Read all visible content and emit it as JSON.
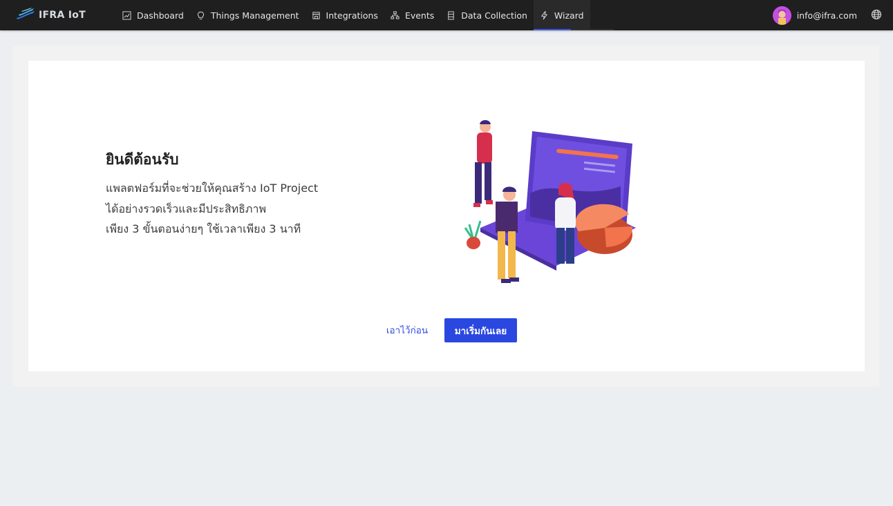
{
  "brand": {
    "name": "IFRA IoT",
    "logo_icon": "ifra-wave-logo"
  },
  "nav": {
    "items": [
      {
        "label": "Dashboard",
        "icon": "line-chart-icon"
      },
      {
        "label": "Things Management",
        "icon": "bulb-icon"
      },
      {
        "label": "Integrations",
        "icon": "storefront-icon"
      },
      {
        "label": "Events",
        "icon": "cluster-icon"
      },
      {
        "label": "Data Collection",
        "icon": "database-icon"
      },
      {
        "label": "Wizard",
        "icon": "thunderbolt-icon",
        "active": true
      }
    ]
  },
  "user": {
    "email": "info@ifra.com",
    "avatar_icon": "user-avatar"
  },
  "language_icon": "globe-icon",
  "welcome": {
    "title": "ยินดีต้อนรับ",
    "lines": [
      "แพลตฟอร์มที่จะช่วยให้คุณสร้าง IoT Project",
      "ได้อย่างรวดเร็วและมีประสิทธิภาพ",
      "เพียง 3 ขั้นตอนง่ายๆ ใช้เวลาเพียง 3 นาที"
    ]
  },
  "actions": {
    "later_label": "เอาไว้ก่อน",
    "start_label": "มาเริ่มกันเลย"
  },
  "colors": {
    "topbar": "#1f1f1f",
    "accent": "#2a48e0",
    "page_bg": "#eceff2",
    "card_bg": "#ffffff"
  }
}
